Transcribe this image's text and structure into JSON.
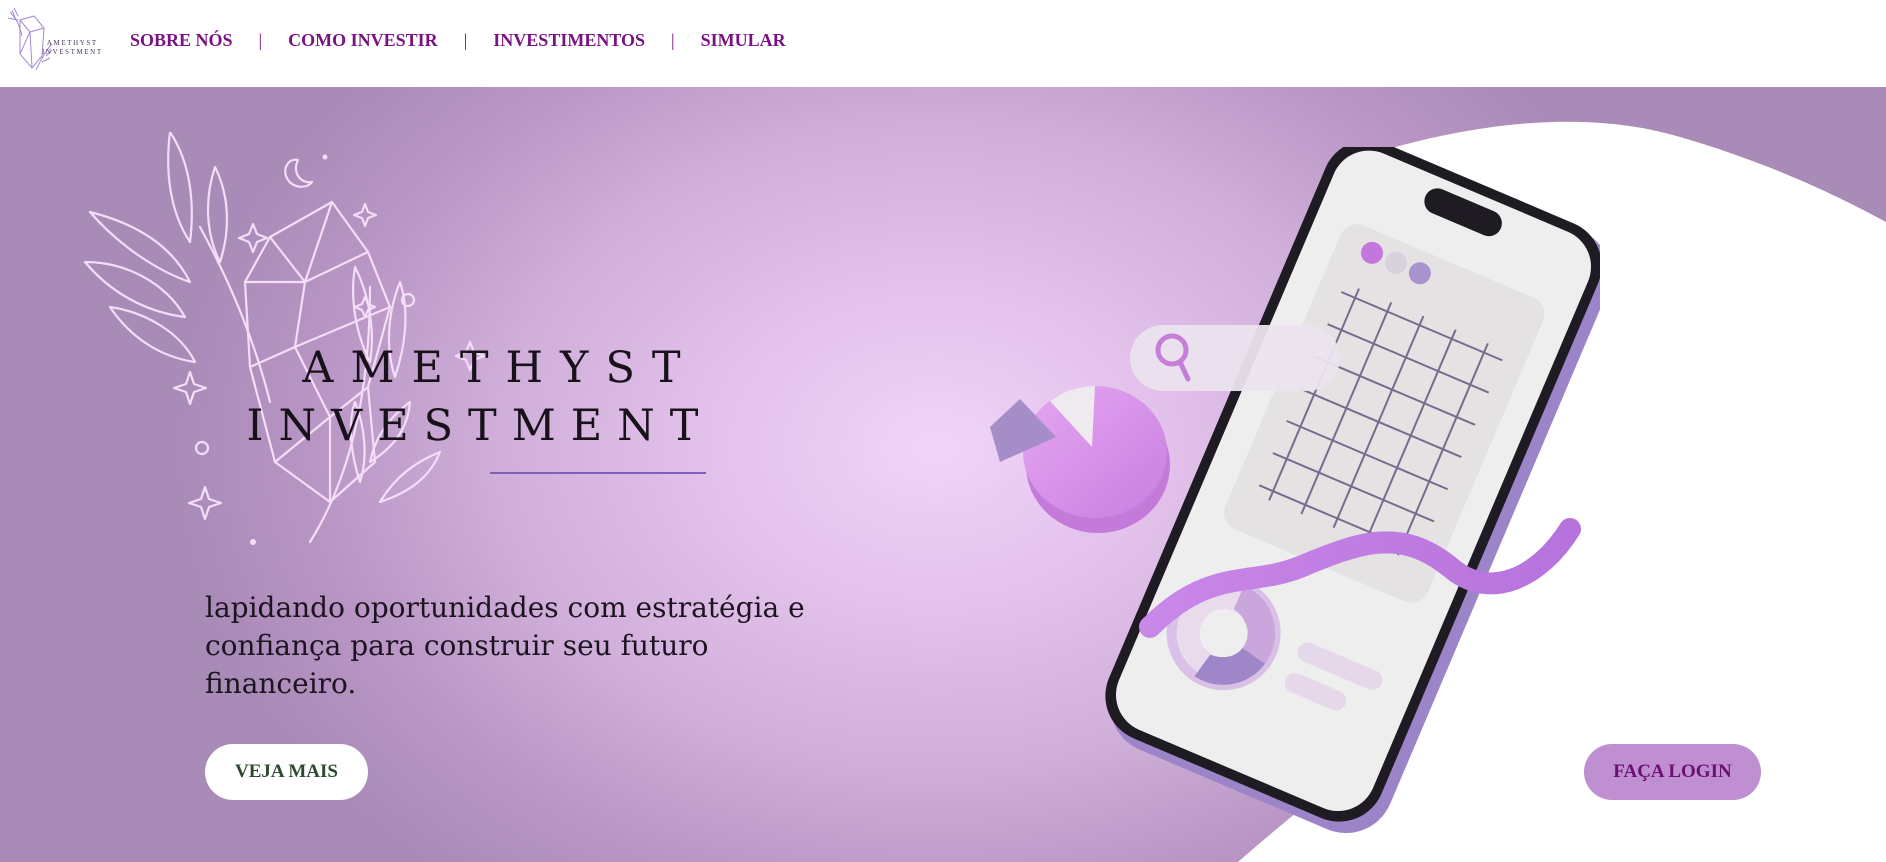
{
  "header": {
    "logo": {
      "line1": "AMETHYST",
      "line2": "INVESTMENT"
    },
    "nav": [
      {
        "label": "SOBRE NÓS"
      },
      {
        "label": "COMO INVESTIR"
      },
      {
        "label": "INVESTIMENTOS"
      },
      {
        "label": "SIMULAR"
      }
    ],
    "separator": "|"
  },
  "hero": {
    "brand_line1": "AMETHYST",
    "brand_line2": "INVESTMENT",
    "tagline": "lapidando oportunidades com estratégia e confiança para construir seu futuro financeiro.",
    "more_button": "VEJA MAIS",
    "login_button": "FAÇA LOGIN"
  },
  "colors": {
    "nav_text": "#7b1283",
    "hero_gradient_center": "#f0d4f8",
    "hero_gradient_edge": "#a98bb8",
    "login_button_bg": "#c08fd2",
    "login_button_text": "#6c0f72",
    "more_button_text": "#2c4a2e",
    "accent_line": "#7a62b8"
  },
  "icons": [
    "amethyst-logo-icon",
    "crystal-leaves-illustration",
    "phone-chart-illustration",
    "pie-chart-icon",
    "search-icon",
    "donut-chart-icon"
  ]
}
